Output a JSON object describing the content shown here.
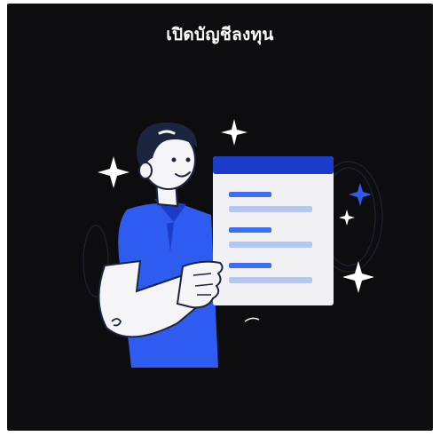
{
  "screen": {
    "title": "เปิดบัญชีลงทุน"
  },
  "colors": {
    "background": "#0d0d10",
    "accent_blue": "#2f5cf0",
    "header_blue": "#1b3cc9",
    "doc_line_blue": "#3c6ef2",
    "doc_line_light": "#b6c7ee",
    "paper": "#f1f1f4",
    "skin": "#f5f5f7",
    "hair": "#1c2540",
    "sparkle": "#ffffff"
  },
  "illustration": {
    "name": "person-holding-document",
    "icons": [
      "sparkle-icon",
      "document-icon"
    ]
  }
}
